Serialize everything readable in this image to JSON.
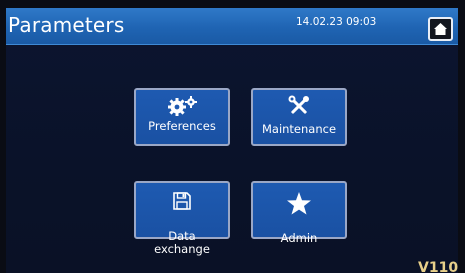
{
  "header": {
    "title": "Parameters",
    "datetime": "14.02.23 09:03",
    "home_icon": "home-icon"
  },
  "tiles": [
    {
      "label": "Preferences",
      "icon": "gears-icon"
    },
    {
      "label": "Maintenance",
      "icon": "tools-icon"
    },
    {
      "label": "Data\nexchange",
      "icon": "floppy-disk-icon"
    },
    {
      "label": "Admin",
      "icon": "star-icon"
    }
  ],
  "version": "V110",
  "colors": {
    "header_blue": "#1f64b3",
    "tile_blue": "#1e5ab1",
    "background": "#0a1229",
    "version_text": "#e8d08a"
  }
}
